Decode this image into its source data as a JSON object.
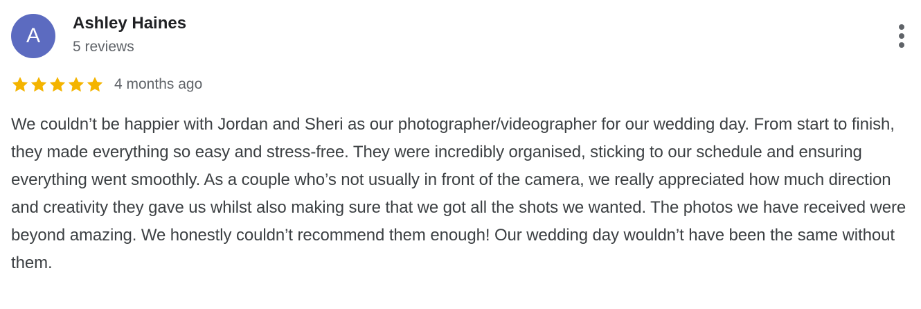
{
  "review": {
    "author_initial": "A",
    "author_name": "Ashley Haines",
    "author_reviews": "5 reviews",
    "avatar_color": "#5c6bc0",
    "rating": 5,
    "rating_max": 5,
    "star_color": "#f4b400",
    "date": "4 months ago",
    "more_icon": "more-vert-icon",
    "text": "We couldn’t be happier with Jordan and Sheri as our photographer/videographer for our wedding day. From start to finish, they made everything so easy and stress-free. They were incredibly organised, sticking to our schedule and ensuring everything went smoothly. As a couple who’s not usually in front of the camera, we really appreciated how much direction and creativity they gave us whilst also making sure that we got all the shots we wanted. The photos we have received were beyond amazing. We honestly couldn’t recommend them enough! Our wedding day wouldn’t have been the same without them."
  }
}
